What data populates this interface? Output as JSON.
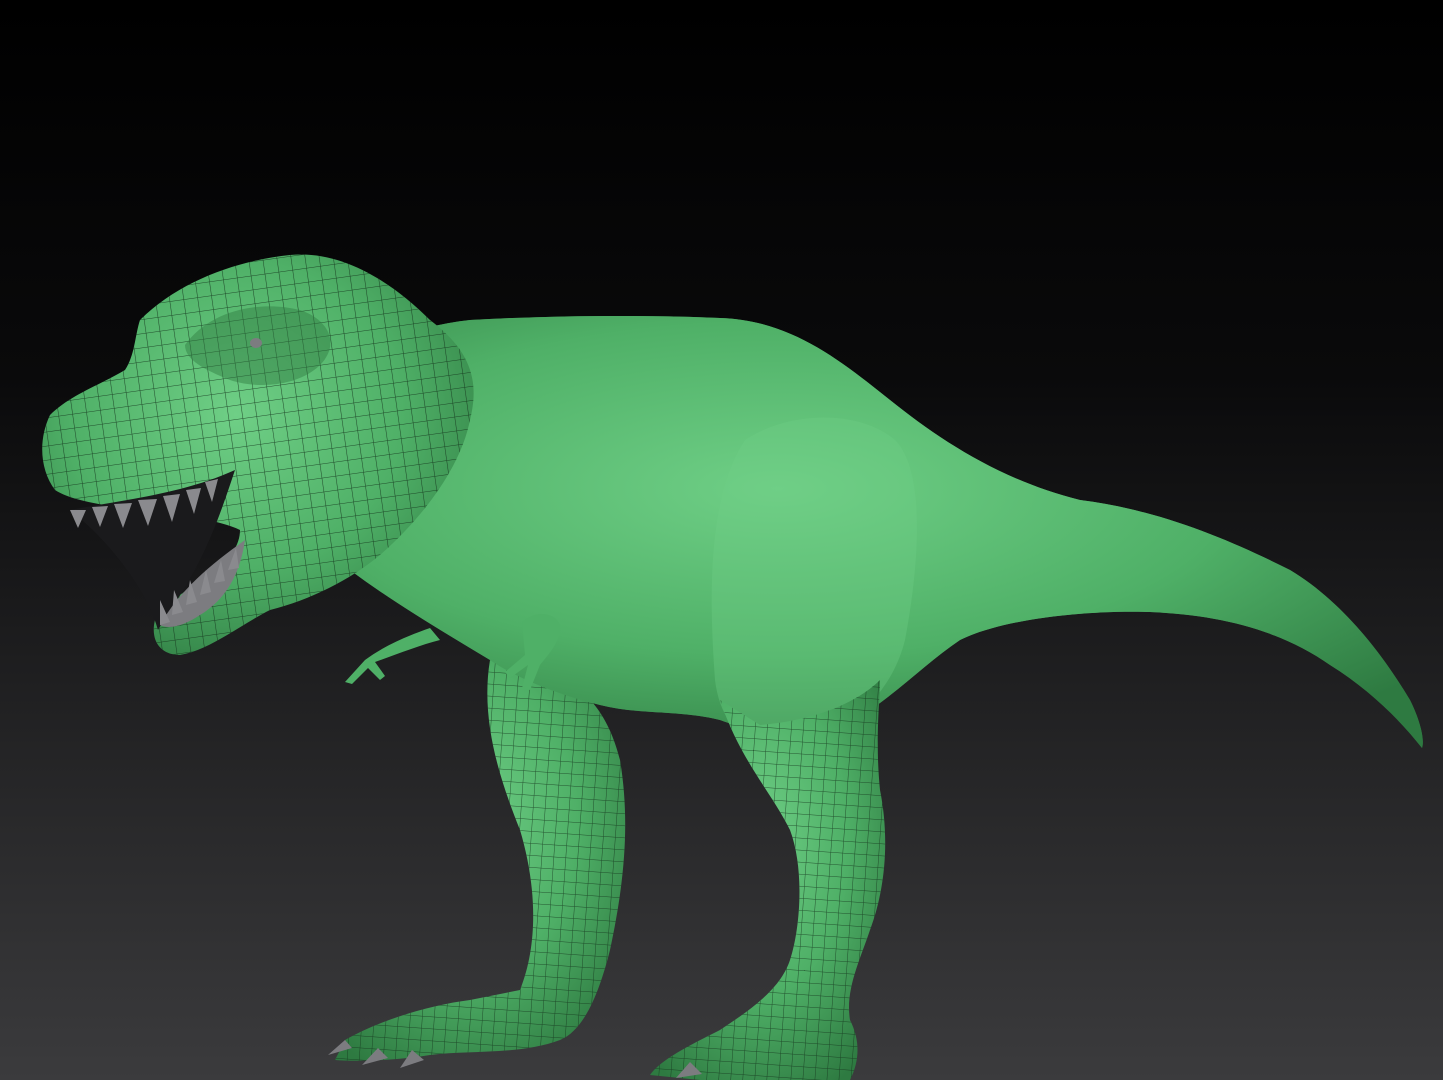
{
  "scene": {
    "background": {
      "top_color": "#000000",
      "bottom_color": "#3b3b3d"
    },
    "model": {
      "subject": "t-rex-icon",
      "mesh_color": "#4fb067",
      "mesh_highlight": "#6fcf86",
      "mesh_shadow": "#2e7a41",
      "wire_color": "#14331c",
      "teeth_color": "#7c7c80"
    }
  }
}
